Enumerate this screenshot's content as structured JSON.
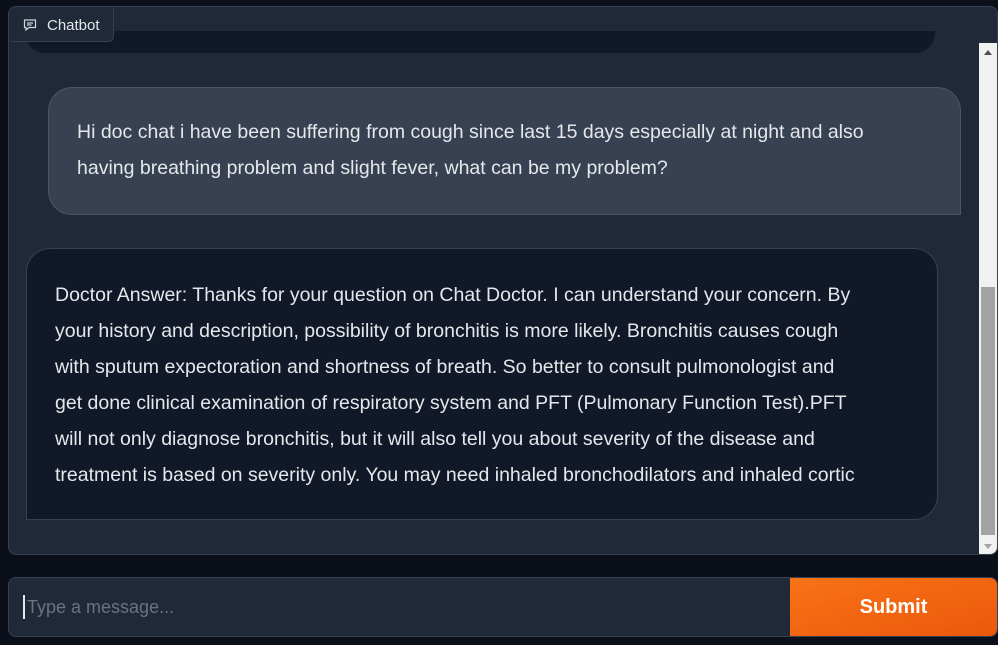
{
  "chatbot": {
    "tab_label": "Chatbot",
    "tab_icon": "chat-bubble-icon",
    "messages": [
      {
        "role": "user",
        "lines": [
          "Hi doc chat i have been suffering from cough since last 15 days especially at night and also",
          "having breathing problem and slight fever, what can be my problem?"
        ]
      },
      {
        "role": "bot",
        "lines": [
          "Doctor Answer: Thanks for your question on Chat Doctor. I can understand your concern. By",
          "your history and description, possibility of bronchitis is more likely. Bronchitis causes cough",
          "with sputum expectoration and shortness of breath. So better to consult pulmonologist and",
          "get done clinical examination of respiratory system and PFT (Pulmonary Function Test).PFT",
          "will not only diagnose bronchitis, but it will also tell you about severity of the disease and",
          "treatment is based on severity only. You may need inhaled bronchodilators and inhaled cortic"
        ]
      }
    ]
  },
  "input": {
    "placeholder": "Type a message...",
    "value": ""
  },
  "submit": {
    "label": "Submit"
  },
  "colors": {
    "page_bg": "#0b0f19",
    "panel_bg": "#1f2937",
    "user_bubble": "#374151",
    "bot_bubble": "#111827",
    "accent": "#f97316"
  }
}
